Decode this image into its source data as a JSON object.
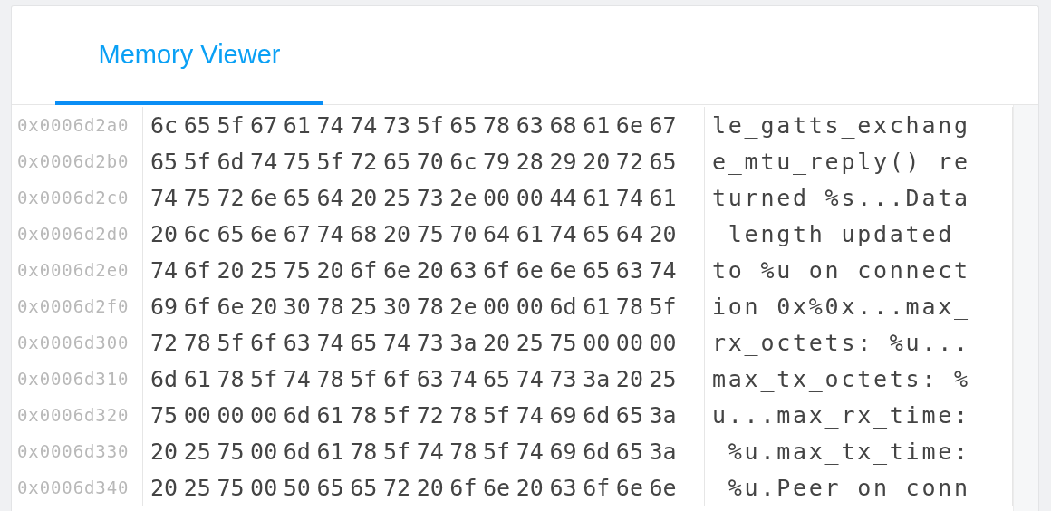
{
  "tabs": [
    {
      "label": "Memory Viewer",
      "selected": true
    }
  ],
  "rows": [
    {
      "address": "0x0006d2a0",
      "bytes": [
        "6c",
        "65",
        "5f",
        "67",
        "61",
        "74",
        "74",
        "73",
        "5f",
        "65",
        "78",
        "63",
        "68",
        "61",
        "6e",
        "67"
      ],
      "ascii": "le_gatts_exchang"
    },
    {
      "address": "0x0006d2b0",
      "bytes": [
        "65",
        "5f",
        "6d",
        "74",
        "75",
        "5f",
        "72",
        "65",
        "70",
        "6c",
        "79",
        "28",
        "29",
        "20",
        "72",
        "65"
      ],
      "ascii": "e_mtu_reply() re"
    },
    {
      "address": "0x0006d2c0",
      "bytes": [
        "74",
        "75",
        "72",
        "6e",
        "65",
        "64",
        "20",
        "25",
        "73",
        "2e",
        "00",
        "00",
        "44",
        "61",
        "74",
        "61"
      ],
      "ascii": "turned %s...Data"
    },
    {
      "address": "0x0006d2d0",
      "bytes": [
        "20",
        "6c",
        "65",
        "6e",
        "67",
        "74",
        "68",
        "20",
        "75",
        "70",
        "64",
        "61",
        "74",
        "65",
        "64",
        "20"
      ],
      "ascii": " length updated"
    },
    {
      "address": "0x0006d2e0",
      "bytes": [
        "74",
        "6f",
        "20",
        "25",
        "75",
        "20",
        "6f",
        "6e",
        "20",
        "63",
        "6f",
        "6e",
        "6e",
        "65",
        "63",
        "74"
      ],
      "ascii": "to %u on connect"
    },
    {
      "address": "0x0006d2f0",
      "bytes": [
        "69",
        "6f",
        "6e",
        "20",
        "30",
        "78",
        "25",
        "30",
        "78",
        "2e",
        "00",
        "00",
        "6d",
        "61",
        "78",
        "5f"
      ],
      "ascii": "ion 0x%0x...max_"
    },
    {
      "address": "0x0006d300",
      "bytes": [
        "72",
        "78",
        "5f",
        "6f",
        "63",
        "74",
        "65",
        "74",
        "73",
        "3a",
        "20",
        "25",
        "75",
        "00",
        "00",
        "00"
      ],
      "ascii": "rx_octets: %u..."
    },
    {
      "address": "0x0006d310",
      "bytes": [
        "6d",
        "61",
        "78",
        "5f",
        "74",
        "78",
        "5f",
        "6f",
        "63",
        "74",
        "65",
        "74",
        "73",
        "3a",
        "20",
        "25"
      ],
      "ascii": "max_tx_octets: %"
    },
    {
      "address": "0x0006d320",
      "bytes": [
        "75",
        "00",
        "00",
        "00",
        "6d",
        "61",
        "78",
        "5f",
        "72",
        "78",
        "5f",
        "74",
        "69",
        "6d",
        "65",
        "3a"
      ],
      "ascii": "u...max_rx_time:"
    },
    {
      "address": "0x0006d330",
      "bytes": [
        "20",
        "25",
        "75",
        "00",
        "6d",
        "61",
        "78",
        "5f",
        "74",
        "78",
        "5f",
        "74",
        "69",
        "6d",
        "65",
        "3a"
      ],
      "ascii": " %u.max_tx_time:"
    },
    {
      "address": "0x0006d340",
      "bytes": [
        "20",
        "25",
        "75",
        "00",
        "50",
        "65",
        "65",
        "72",
        "20",
        "6f",
        "6e",
        "20",
        "63",
        "6f",
        "6e",
        "6e"
      ],
      "ascii": " %u.Peer on conn"
    }
  ]
}
